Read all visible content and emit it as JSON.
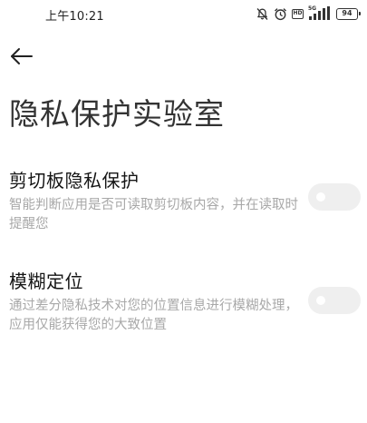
{
  "status_bar": {
    "time": "上午10:21",
    "network": "5G",
    "hd": "HD",
    "battery": "94",
    "icons": [
      "mute-icon",
      "alarm-icon",
      "hd-icon",
      "signal-icon",
      "battery-icon"
    ]
  },
  "nav": {
    "back_icon": "arrow-left-icon"
  },
  "page": {
    "title": "隐私保护实验室"
  },
  "settings": [
    {
      "title": "剪切板隐私保护",
      "description": "智能判断应用是否可读取剪切板内容，并在读取时提醒您",
      "enabled": false
    },
    {
      "title": "模糊定位",
      "description": "通过差分隐私技术对您的位置信息进行模糊处理，应用仅能获得您的大致位置",
      "enabled": false
    }
  ],
  "colors": {
    "background": "#ffffff",
    "title_text": "#333333",
    "item_title": "#151515",
    "description": "#a8a8a8",
    "toggle_off": "#efefef"
  }
}
